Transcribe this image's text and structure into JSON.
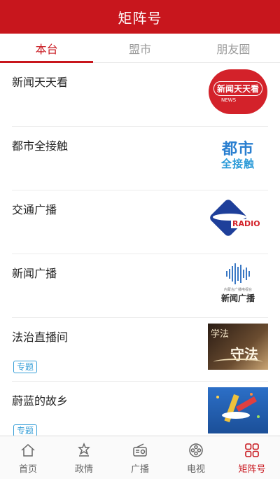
{
  "header": {
    "title": "矩阵号"
  },
  "tabs": [
    {
      "label": "本台",
      "active": true
    },
    {
      "label": "盟市",
      "active": false
    },
    {
      "label": "朋友圈",
      "active": false
    }
  ],
  "list": [
    {
      "title": "新闻天天看",
      "logo": "news-everyday-logo",
      "logo_text": "新闻天天看",
      "logo_sub": "NEWS"
    },
    {
      "title": "都市全接触",
      "logo": "dushi-logo",
      "logo_top": "都市",
      "logo_bottom": "全接触"
    },
    {
      "title": "交通广播",
      "logo": "traffic-radio-logo",
      "logo_text": "RADIO"
    },
    {
      "title": "新闻广播",
      "logo": "news-broadcast-logo",
      "logo_small": "内蒙古广播电视台",
      "logo_label": "新闻广播"
    },
    {
      "title": "法治直播间",
      "tag": "专题",
      "logo": "law-logo",
      "logo_t1": "学法",
      "logo_t2": "守法"
    },
    {
      "title": "蔚蓝的故乡",
      "tag": "专题",
      "logo": "hometown-image"
    }
  ],
  "tabbar": [
    {
      "label": "首页",
      "icon": "home-icon",
      "active": false
    },
    {
      "label": "政情",
      "icon": "politics-icon",
      "active": false
    },
    {
      "label": "广播",
      "icon": "radio-icon",
      "active": false
    },
    {
      "label": "电视",
      "icon": "tv-icon",
      "active": false
    },
    {
      "label": "矩阵号",
      "icon": "matrix-icon",
      "active": true
    }
  ],
  "colors": {
    "accent": "#c8161d",
    "tag": "#3aa0d8"
  }
}
